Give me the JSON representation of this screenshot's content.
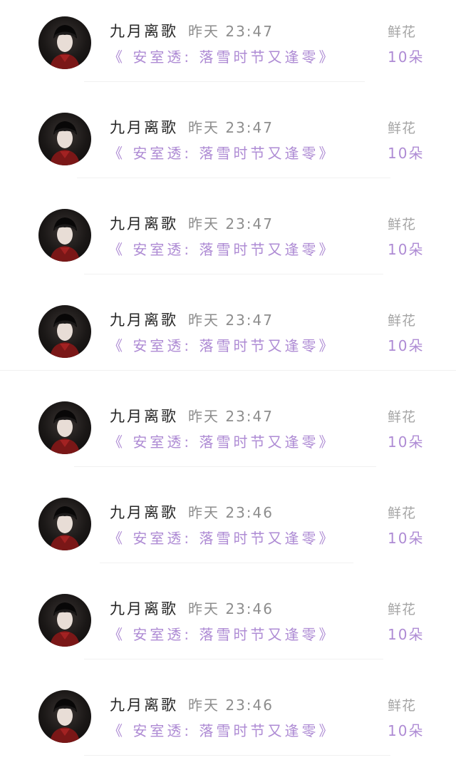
{
  "comments": [
    {
      "user": "九月离歌",
      "time": "昨天 23:47",
      "work_title": "《 安室透: 落雪时节又逢零》",
      "gift_label": "鲜花",
      "gift_count": "10朵",
      "avatar_icon": "user-avatar-icon"
    },
    {
      "user": "九月离歌",
      "time": "昨天 23:47",
      "work_title": "《 安室透: 落雪时节又逢零》",
      "gift_label": "鲜花",
      "gift_count": "10朵",
      "avatar_icon": "user-avatar-icon"
    },
    {
      "user": "九月离歌",
      "time": "昨天 23:47",
      "work_title": "《 安室透: 落雪时节又逢零》",
      "gift_label": "鲜花",
      "gift_count": "10朵",
      "avatar_icon": "user-avatar-icon"
    },
    {
      "user": "九月离歌",
      "time": "昨天 23:47",
      "work_title": "《 安室透: 落雪时节又逢零》",
      "gift_label": "鲜花",
      "gift_count": "10朵",
      "avatar_icon": "user-avatar-icon"
    },
    {
      "user": "九月离歌",
      "time": "昨天 23:47",
      "work_title": "《 安室透: 落雪时节又逢零》",
      "gift_label": "鲜花",
      "gift_count": "10朵",
      "avatar_icon": "user-avatar-icon"
    },
    {
      "user": "九月离歌",
      "time": "昨天 23:46",
      "work_title": "《 安室透: 落雪时节又逢零》",
      "gift_label": "鲜花",
      "gift_count": "10朵",
      "avatar_icon": "user-avatar-icon"
    },
    {
      "user": "九月离歌",
      "time": "昨天 23:46",
      "work_title": "《 安室透: 落雪时节又逢零》",
      "gift_label": "鲜花",
      "gift_count": "10朵",
      "avatar_icon": "user-avatar-icon"
    },
    {
      "user": "九月离歌",
      "time": "昨天 23:46",
      "work_title": "《 安室透: 落雪时节又逢零》",
      "gift_label": "鲜花",
      "gift_count": "10朵",
      "avatar_icon": "user-avatar-icon"
    }
  ],
  "colors": {
    "accent_purple": "#ae8bd4",
    "name_text": "#262626",
    "meta_gray": "#8d8d8d",
    "background": "#ffffff"
  }
}
